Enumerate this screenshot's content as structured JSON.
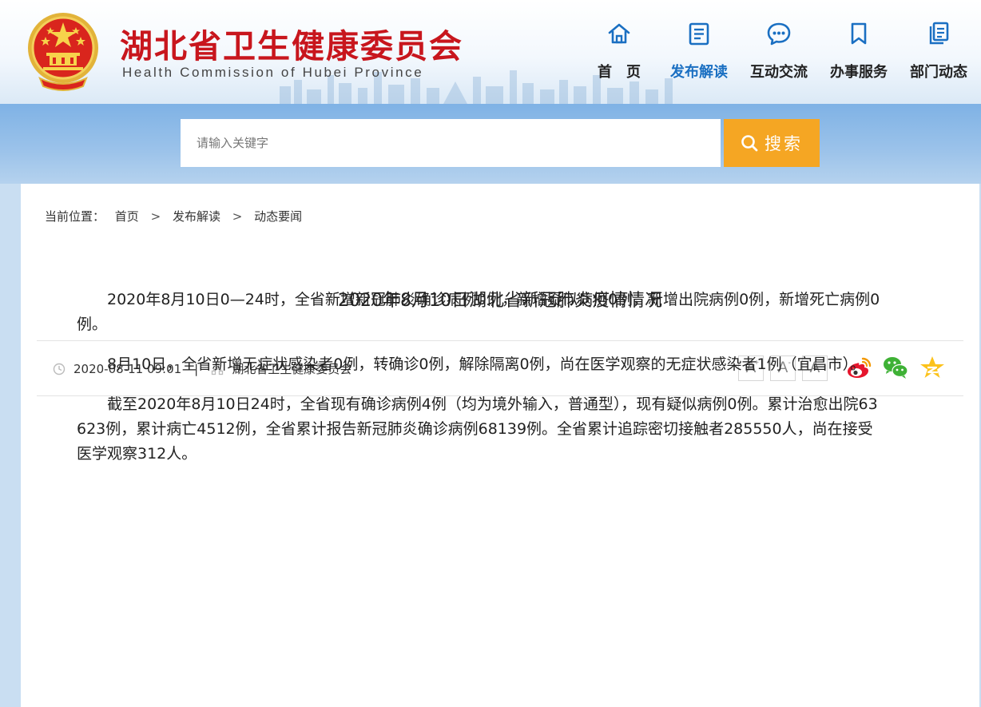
{
  "header": {
    "title": "湖北省卫生健康委员会",
    "subtitle": "Health Commission of Hubei Province",
    "brand_color": "#c8161d"
  },
  "nav": {
    "items": [
      {
        "label": "首　页",
        "icon": "home-icon"
      },
      {
        "label": "发布解读",
        "icon": "document-icon",
        "active": true
      },
      {
        "label": "互动交流",
        "icon": "chat-bubble-icon"
      },
      {
        "label": "办事服务",
        "icon": "bookmark-icon"
      },
      {
        "label": "部门动态",
        "icon": "pages-icon"
      }
    ],
    "active_color": "#1a6fc2"
  },
  "search": {
    "placeholder": "请输入关键字",
    "button_label": "搜索",
    "button_color": "#f5a623"
  },
  "breadcrumb": {
    "prefix": "当前位置：",
    "items": [
      "首页",
      "发布解读",
      "动态要闻"
    ],
    "separator": ">"
  },
  "article": {
    "title": "2020年8月10日湖北省新冠肺炎疫情情况",
    "datetime": "2020-08-11 09:01",
    "source": "湖北省卫生健康委员会",
    "font_controls": [
      "A",
      "A",
      "A"
    ],
    "share": [
      "weibo-icon",
      "wechat-icon",
      "qzone-icon"
    ],
    "paragraphs": [
      "2020年8月10日0—24时，全省新增新冠肺炎确诊病例0例，新增疑似病例0例，新增出院病例0例，新增死亡病例0例。",
      "8月10日，全省新增无症状感染者0例，转确诊0例，解除隔离0例，尚在医学观察的无症状感染者1例（宜昌市）。",
      "截至2020年8月10日24时，全省现有确诊病例4例（均为境外输入，普通型），现有疑似病例0例。累计治愈出院63623例，累计病亡4512例，全省累计报告新冠肺炎确诊病例68139例。全省累计追踪密切接触者285550人，尚在接受医学观察312人。"
    ]
  }
}
